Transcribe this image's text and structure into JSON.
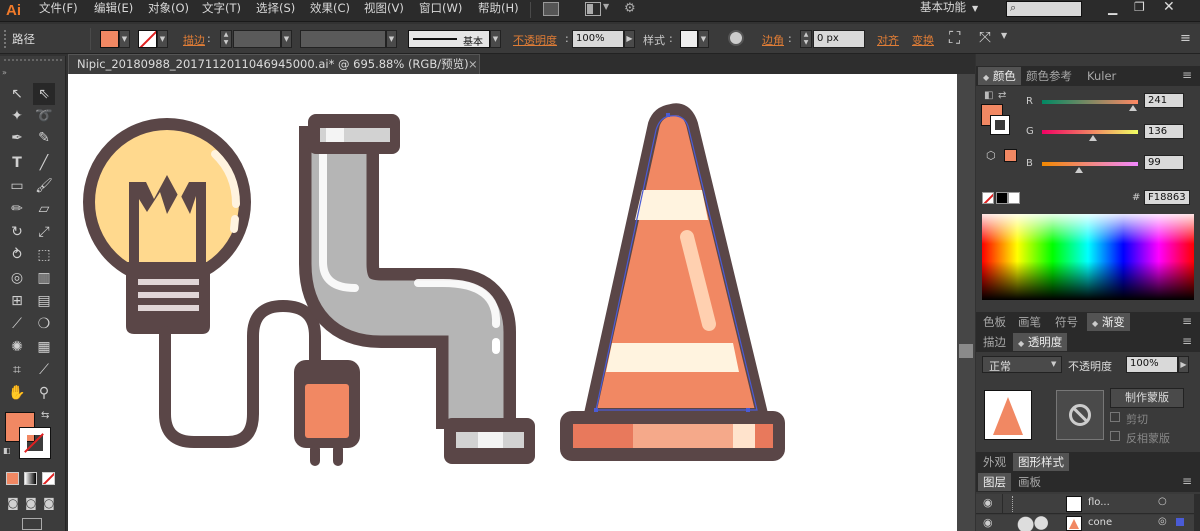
{
  "app": {
    "logo": "Ai",
    "workspace": "基本功能"
  },
  "menu": [
    {
      "label": "文件(F)"
    },
    {
      "label": "编辑(E)"
    },
    {
      "label": "对象(O)"
    },
    {
      "label": "文字(T)"
    },
    {
      "label": "选择(S)"
    },
    {
      "label": "效果(C)"
    },
    {
      "label": "视图(V)"
    },
    {
      "label": "窗口(W)"
    },
    {
      "label": "帮助(H)"
    }
  ],
  "control": {
    "selection_type": "路径",
    "fill_color": "#F18863",
    "stroke_label": "描边",
    "stroke_style": "基本",
    "opacity_label": "不透明度",
    "opacity_value": "100%",
    "style_label": "样式",
    "corner_label": "边角",
    "corner_value": "0 px",
    "align_label": "对齐",
    "transform_label": "变换"
  },
  "document": {
    "tab_title": "Nipic_20180988_20171120110469450​00.ai* @ 695.88% (RGB/预览)"
  },
  "color_panel": {
    "tabs": [
      {
        "label": "颜色"
      },
      {
        "label": "颜色参考"
      },
      {
        "label": "Kuler"
      }
    ],
    "channels": [
      {
        "name": "R",
        "value": "241",
        "fraction": 0.945
      },
      {
        "name": "G",
        "value": "136",
        "fraction": 0.533
      },
      {
        "name": "B",
        "value": "99",
        "fraction": 0.388
      }
    ],
    "hex_prefix": "#",
    "hex": "F18863"
  },
  "swatch_tabs": [
    {
      "label": "色板"
    },
    {
      "label": "画笔"
    },
    {
      "label": "符号"
    },
    {
      "label": "渐变"
    }
  ],
  "transparency_panel": {
    "tabs": [
      {
        "label": "描边"
      },
      {
        "label": "透明度"
      }
    ],
    "blend_mode": "正常",
    "opacity_label": "不透明度",
    "opacity_value": "100%",
    "make_mask": "制作蒙版",
    "clip": "剪切",
    "invert_mask": "反相蒙版"
  },
  "appearance_tabs": [
    {
      "label": "外观"
    },
    {
      "label": "图形样式"
    }
  ],
  "layers_panel": {
    "tabs": [
      {
        "label": "图层"
      },
      {
        "label": "画板"
      }
    ],
    "layers": [
      {
        "name": "flo..."
      },
      {
        "name": "cone"
      }
    ]
  },
  "colors": {
    "accent": "#F18863",
    "dark_outline": "#5a4647",
    "bulb": "#ffd98e",
    "pipe": "#b5b5b5",
    "cream": "#fff3df",
    "selection": "#4a5bd6"
  }
}
